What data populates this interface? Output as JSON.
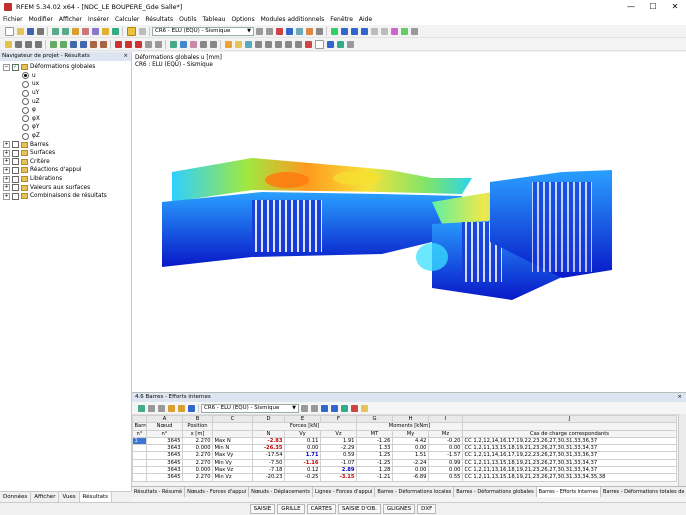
{
  "window": {
    "title": "RFEM 5.34.02 x64 - [NDC_LE BOUPERE_Gde Salle*]",
    "controls": [
      "—",
      "☐",
      "✕"
    ]
  },
  "menu": [
    "Fichier",
    "Modifier",
    "Afficher",
    "Insérer",
    "Calculer",
    "Résultats",
    "Outils",
    "Tableau",
    "Options",
    "Modules additionnels",
    "Fenêtre",
    "Aide"
  ],
  "toolbar": {
    "load_combo": "CR6 - ELU (EQU) - Sismique"
  },
  "navigator": {
    "title": "Navigateur de projet - Résultats",
    "close": "×",
    "root": "Déformations globales",
    "options": [
      {
        "label": "u",
        "selected": true
      },
      {
        "label": "ux",
        "selected": false
      },
      {
        "label": "uY",
        "selected": false
      },
      {
        "label": "uZ",
        "selected": false
      },
      {
        "label": "φ",
        "selected": false
      },
      {
        "label": "φX",
        "selected": false
      },
      {
        "label": "φY",
        "selected": false
      },
      {
        "label": "φZ",
        "selected": false
      }
    ],
    "groups": [
      "Barres",
      "Surfaces",
      "Critère",
      "Réactions d'appui",
      "Libérations",
      "Valeurs aux surfaces",
      "Combinaisons de résultats"
    ],
    "tabs": [
      "Données",
      "Afficher",
      "Vues",
      "Résultats"
    ]
  },
  "view": {
    "line1": "Déformations globales u [mm]",
    "line2": "CR6 : ELU (EQU) - Sismique"
  },
  "panel": {
    "title": "4.6 Barres - Efforts internes",
    "close": "×",
    "combo": "CR6 - ELU (EQU) - Sismique",
    "col_letters": [
      "A",
      "B",
      "C",
      "D",
      "E",
      "F",
      "G",
      "H",
      "I",
      "J"
    ],
    "header1": [
      "Barre",
      "Nœud",
      "Position",
      "",
      "Forces [kN]",
      "Moments [kNm]",
      ""
    ],
    "header2": [
      "n°",
      "n°",
      "x [m]",
      "",
      "N",
      "Vy",
      "Vz",
      "MT",
      "My",
      "Mz",
      "Cas de charge correspondants"
    ],
    "rows": [
      {
        "bar": "1",
        "node": "3645",
        "pos": "2.270",
        "type": "Max N",
        "N": "-2.83",
        "Vy": "0.11",
        "Vz": "1.91",
        "MT": "-1.26",
        "My": "4.42",
        "Mz": "-0.20",
        "cases": "CC 1,2,12,14,16,17,19,22,23,26,27,30,31,33,36,37"
      },
      {
        "bar": "",
        "node": "3643",
        "pos": "0.000",
        "type": "Min N",
        "N": "-26.35",
        "Vy": "0.00",
        "Vz": "-2.29",
        "MT": "1.33",
        "My": "0.00",
        "Mz": "0.00",
        "cases": "CC 1,2,11,13,15,18,19,21,23,26,27,30,31,33,34,37"
      },
      {
        "bar": "",
        "node": "3645",
        "pos": "2.270",
        "type": "Max Vy",
        "N": "-17.54",
        "Vy": "1.71",
        "Vz": "0.59",
        "MT": "1.25",
        "My": "1.51",
        "Mz": "-1.57",
        "cases": "CC 1,2,11,14,16,17,19,22,23,26,27,30,31,33,36,37"
      },
      {
        "bar": "",
        "node": "3645",
        "pos": "2.270",
        "type": "Min Vy",
        "N": "-7.50",
        "Vy": "-1.16",
        "Vz": "-1.07",
        "MT": "-1.25",
        "My": "-2.24",
        "Mz": "0.99",
        "cases": "CC 1,2,11,13,15,18,19,21,23,26,27,30,31,33,34,37"
      },
      {
        "bar": "",
        "node": "3643",
        "pos": "0.000",
        "type": "Max Vz",
        "N": "-7.18",
        "Vy": "0.12",
        "Vz": "2.89",
        "MT": "1.28",
        "My": "0.00",
        "Mz": "0.00",
        "cases": "CC 1,2,11,13,16,18,19,21,23,26,27,30,31,33,34,37"
      },
      {
        "bar": "",
        "node": "3645",
        "pos": "2.270",
        "type": "Min Vz",
        "N": "-20.23",
        "Vy": "-0.25",
        "Vz": "-3.15",
        "MT": "-1.21",
        "My": "-6.89",
        "Mz": "0.55",
        "cases": "CC 1,2,11,13,15,18,19,21,23,26,27,30,31,33,34,35,38"
      }
    ]
  },
  "result_tabs": [
    "Résultats - Résumé",
    "Nœuds - Forces d'appui",
    "Nœuds - Déplacements",
    "Lignes - Forces d'appui",
    "Barres - Déformations locales",
    "Barres - Déformations globales",
    "Barres - Efforts internes",
    "Barres - Déformations totales de section"
  ],
  "status": [
    "SAISIE",
    "GRILLE",
    "CARTES",
    "SAISIE D'OB.",
    "GLIGNES",
    "DXF"
  ]
}
